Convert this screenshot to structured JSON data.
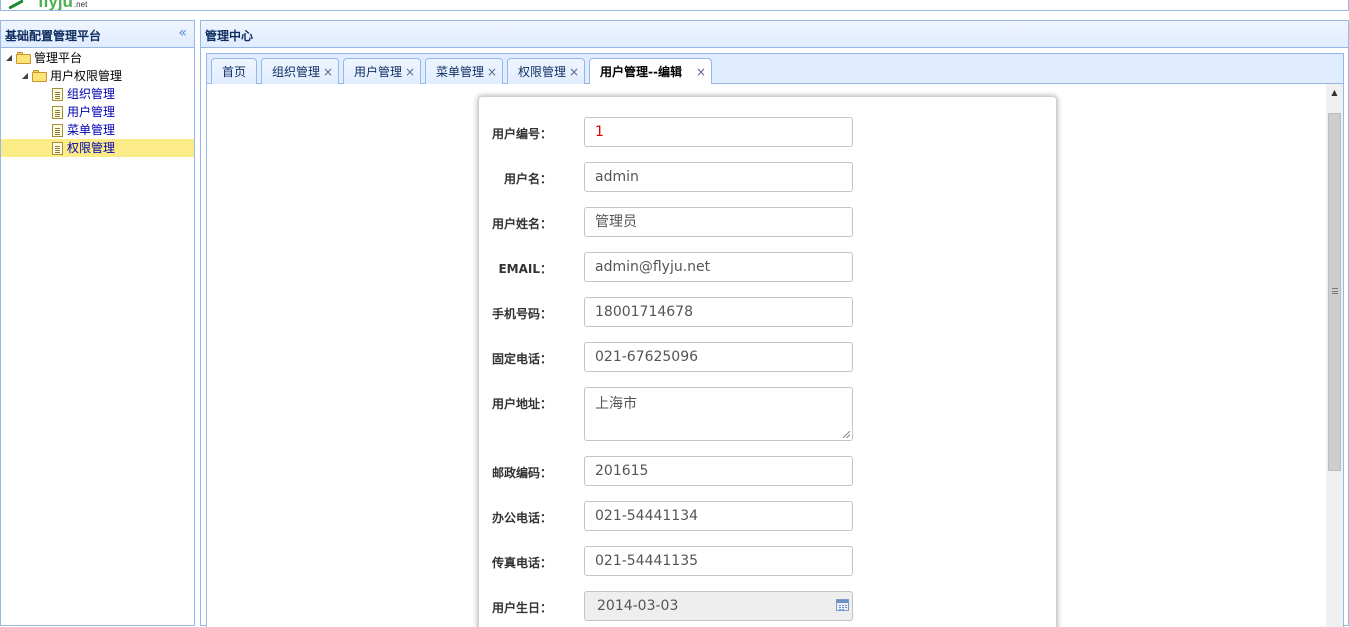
{
  "logo": {
    "word": "flyju",
    "tld": ".net"
  },
  "west": {
    "title": "基础配置管理平台",
    "collapse_icon": "double-chevron-left-icon",
    "tree": [
      {
        "label": "管理平台",
        "type": "folder",
        "level": 0
      },
      {
        "label": "用户权限管理",
        "type": "folder",
        "level": 1
      },
      {
        "label": "组织管理",
        "type": "file",
        "level": 2
      },
      {
        "label": "用户管理",
        "type": "file",
        "level": 2
      },
      {
        "label": "菜单管理",
        "type": "file",
        "level": 2
      },
      {
        "label": "权限管理",
        "type": "file",
        "level": 2,
        "selected": true
      }
    ]
  },
  "center": {
    "title": "管理中心",
    "tabs": [
      {
        "label": "首页",
        "closable": false
      },
      {
        "label": "组织管理",
        "closable": true
      },
      {
        "label": "用户管理",
        "closable": true
      },
      {
        "label": "菜单管理",
        "closable": true
      },
      {
        "label": "权限管理",
        "closable": true
      },
      {
        "label": "用户管理--编辑",
        "closable": true,
        "active": true
      }
    ],
    "close_glyph": "×"
  },
  "form": {
    "fields": [
      {
        "label": "用户编号：",
        "value": "1"
      },
      {
        "label": "用户名：",
        "value": "admin"
      },
      {
        "label": "用户姓名：",
        "value": "管理员"
      },
      {
        "label": "EMAIL：",
        "value": "admin@flyju.net"
      },
      {
        "label": "手机号码：",
        "value": "18001714678"
      },
      {
        "label": "固定电话：",
        "value": "021-67625096"
      },
      {
        "label": "用户地址：",
        "value": "上海市"
      },
      {
        "label": "邮政编码：",
        "value": "201615"
      },
      {
        "label": "办公电话：",
        "value": "021-54441134"
      },
      {
        "label": "传真电话：",
        "value": "021-54441135"
      },
      {
        "label": "用户生日：",
        "value": "2014-03-03"
      }
    ]
  },
  "colors": {
    "border": "#95b8e7",
    "header_bg": "#e0ecff",
    "selected_bg": "#fbec88",
    "link": "#0000b3",
    "id_red": "#e00000"
  }
}
